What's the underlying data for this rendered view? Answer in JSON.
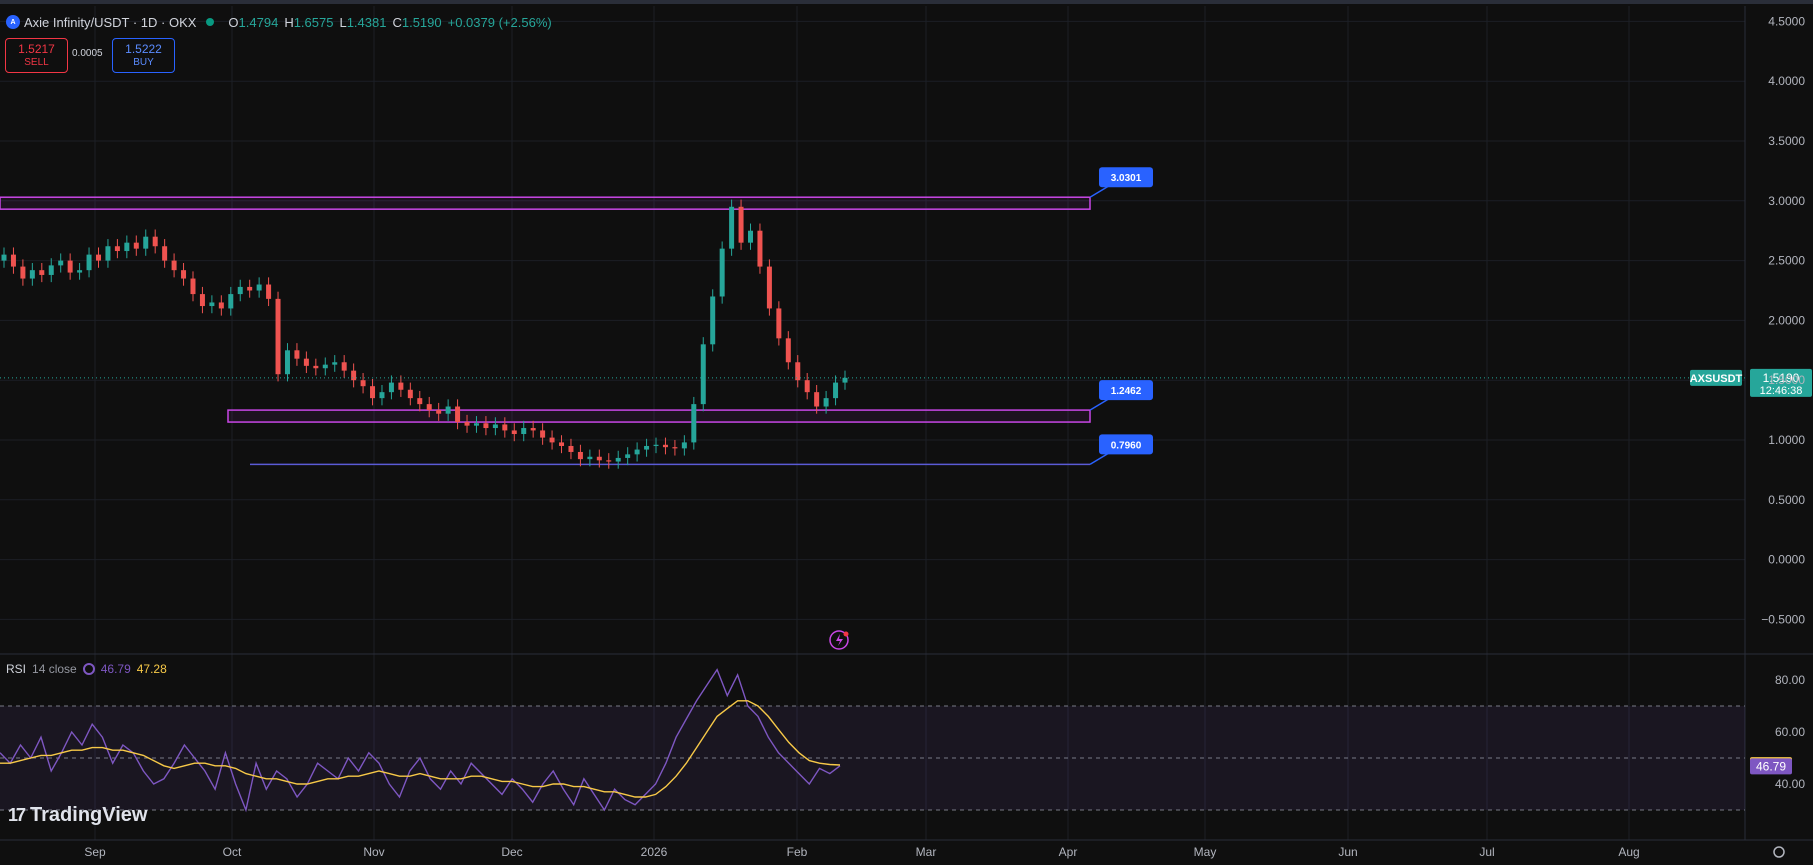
{
  "header": {
    "symbol_icon": "axs-coin-icon",
    "title": "Axie Infinity/USDT · 1D · OKX",
    "ohlc": {
      "o_label": "O",
      "o": "1.4794",
      "h_label": "H",
      "h": "1.6575",
      "l_label": "L",
      "l": "1.4381",
      "c_label": "C",
      "c": "1.5190",
      "change": "+0.0379 (+2.56%)"
    }
  },
  "trade": {
    "sell_price": "1.5217",
    "sell_label": "SELL",
    "spread": "0.0005",
    "buy_price": "1.5222",
    "buy_label": "BUY"
  },
  "rsi_legend": {
    "name": "RSI",
    "params": "14 close",
    "rsi_value": "46.79",
    "ma_value": "47.28"
  },
  "branding": {
    "logo_text": "TradingView"
  },
  "colors": {
    "background": "#0f0f0f",
    "up": "#26a69a",
    "down": "#ef5350",
    "zone": "#c846e6",
    "support_line": "#5b5bd6",
    "label_blue": "#2962ff",
    "rsi_line": "#7e57c2",
    "rsi_ma": "#f7c948"
  },
  "chart_data": [
    {
      "type": "candlestick",
      "symbol": "AXSUSDT",
      "x_ticks": [
        "Sep",
        "Oct",
        "Nov",
        "Dec",
        "2026",
        "Feb",
        "Mar",
        "Apr",
        "May",
        "Jun",
        "Jul",
        "Aug"
      ],
      "y_ticks": [
        "4.5000",
        "4.0000",
        "3.5000",
        "3.0000",
        "2.5000",
        "2.0000",
        "1.5000",
        "1.0000",
        "0.5000",
        "0.0000",
        "−0.5000"
      ],
      "ylim": [
        -0.5,
        4.5
      ],
      "last_price": {
        "symbol_label": "AXSUSDT",
        "value": "1.5190",
        "countdown": "12:46:38"
      },
      "levels": [
        {
          "label": "3.0301",
          "value": 3.0301,
          "kind": "zone",
          "range": [
            2.93,
            3.03
          ]
        },
        {
          "label": "1.2462",
          "value": 1.2462,
          "kind": "zone",
          "range": [
            1.15,
            1.25
          ]
        },
        {
          "label": "0.7960",
          "value": 0.796,
          "kind": "line"
        }
      ],
      "close_series": {
        "start_month": "Aug",
        "closes": [
          2.55,
          2.45,
          2.35,
          2.42,
          2.38,
          2.46,
          2.5,
          2.4,
          2.42,
          2.55,
          2.5,
          2.62,
          2.58,
          2.65,
          2.6,
          2.7,
          2.62,
          2.5,
          2.42,
          2.35,
          2.22,
          2.12,
          2.15,
          2.1,
          2.22,
          2.28,
          2.25,
          2.3,
          2.18,
          1.55,
          1.75,
          1.68,
          1.62,
          1.6,
          1.63,
          1.65,
          1.58,
          1.5,
          1.45,
          1.35,
          1.4,
          1.48,
          1.42,
          1.35,
          1.3,
          1.25,
          1.22,
          1.28,
          1.15,
          1.12,
          1.14,
          1.1,
          1.13,
          1.08,
          1.05,
          1.1,
          1.08,
          1.02,
          0.98,
          0.95,
          0.9,
          0.84,
          0.86,
          0.83,
          0.82,
          0.85,
          0.88,
          0.92,
          0.95,
          0.96,
          0.94,
          0.93,
          0.98,
          1.3,
          1.8,
          2.2,
          2.6,
          2.95,
          2.65,
          2.75,
          2.45,
          2.1,
          1.85,
          1.65,
          1.5,
          1.4,
          1.28,
          1.35,
          1.48,
          1.52
        ]
      }
    },
    {
      "type": "line",
      "name": "RSI 14 close",
      "y_ticks": [
        "80.00",
        "60.00",
        "40.00"
      ],
      "ylim": [
        25,
        85
      ],
      "bands": [
        70,
        50,
        30
      ],
      "current": {
        "rsi": "46.79",
        "ma": "47.28"
      },
      "series": [
        {
          "name": "RSI",
          "values": [
            52,
            48,
            55,
            50,
            58,
            45,
            52,
            60,
            55,
            63,
            58,
            48,
            55,
            52,
            45,
            40,
            42,
            48,
            55,
            50,
            45,
            38,
            52,
            40,
            30,
            48,
            38,
            45,
            42,
            35,
            40,
            48,
            45,
            42,
            50,
            45,
            52,
            48,
            40,
            35,
            45,
            50,
            42,
            38,
            45,
            40,
            48,
            44,
            40,
            36,
            42,
            38,
            33,
            40,
            45,
            38,
            32,
            42,
            36,
            30,
            38,
            34,
            32,
            36,
            40,
            48,
            58,
            65,
            72,
            78,
            84,
            74,
            82,
            70,
            66,
            58,
            52,
            48,
            44,
            40,
            46,
            44,
            47
          ]
        },
        {
          "name": "RSI MA",
          "values": [
            48,
            48,
            49,
            50,
            51,
            51,
            52,
            53,
            53,
            54,
            54,
            53,
            53,
            52,
            51,
            49,
            47,
            46,
            47,
            48,
            48,
            47,
            47,
            46,
            44,
            43,
            42,
            42,
            41,
            40,
            40,
            41,
            42,
            42,
            43,
            43,
            44,
            45,
            44,
            43,
            43,
            44,
            43,
            42,
            42,
            42,
            43,
            43,
            42,
            41,
            41,
            40,
            39,
            39,
            40,
            40,
            39,
            39,
            38,
            37,
            37,
            36,
            35,
            35,
            36,
            39,
            43,
            48,
            54,
            60,
            66,
            69,
            72,
            72,
            70,
            66,
            61,
            56,
            52,
            49,
            48,
            47.5,
            47.3
          ]
        }
      ]
    }
  ]
}
